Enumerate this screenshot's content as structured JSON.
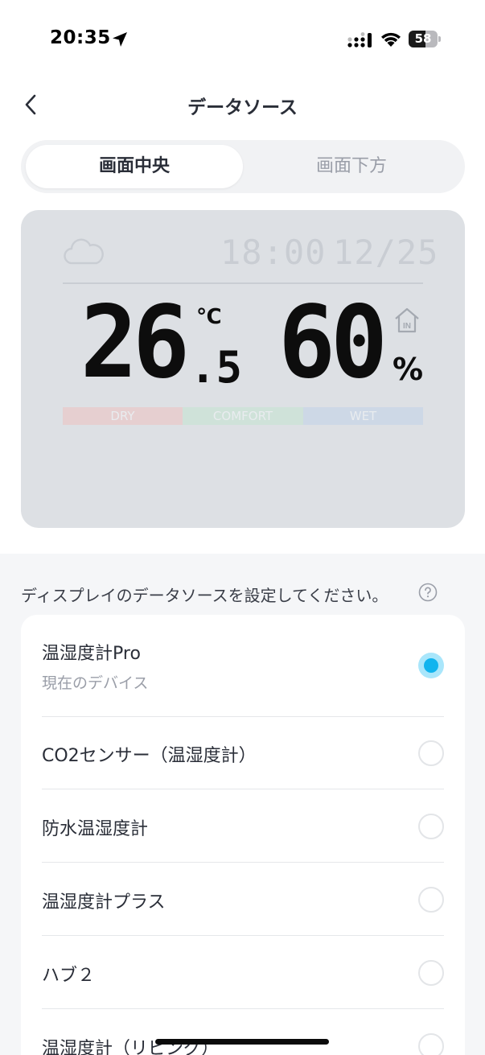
{
  "status_bar": {
    "time": "20:35",
    "battery_level": 58,
    "battery_text": "58"
  },
  "header": {
    "title": "データソース"
  },
  "tabs": [
    {
      "label": "画面中央",
      "selected": true
    },
    {
      "label": "画面下方",
      "selected": false
    }
  ],
  "preview": {
    "time": "18:00",
    "date": "12/25",
    "temperature_int": "26",
    "temperature_dec": ".5",
    "temperature_unit": "℃",
    "humidity": "60",
    "humidity_unit": "%",
    "indoor_badge": "IN",
    "comfort_levels": [
      "DRY",
      "COMFORT",
      "WET"
    ],
    "colors": {
      "dry": "#e6cfd0",
      "comfort": "#cfe2d9",
      "wet": "#cdd8e6"
    }
  },
  "settings": {
    "hint": "ディスプレイのデータソースを設定してください。",
    "sources": [
      {
        "title": "温湿度計Pro",
        "subtitle": "現在のデバイス",
        "selected": true
      },
      {
        "title": "CO2センサー（温湿度計）",
        "selected": false
      },
      {
        "title": "防水温湿度計",
        "selected": false
      },
      {
        "title": "温湿度計プラス",
        "selected": false
      },
      {
        "title": "ハブ２",
        "selected": false
      },
      {
        "title": "温湿度計（リビング）",
        "selected": false
      }
    ]
  },
  "colors": {
    "accent": "#11b4ee",
    "accent_light": "#a9e6fb"
  }
}
